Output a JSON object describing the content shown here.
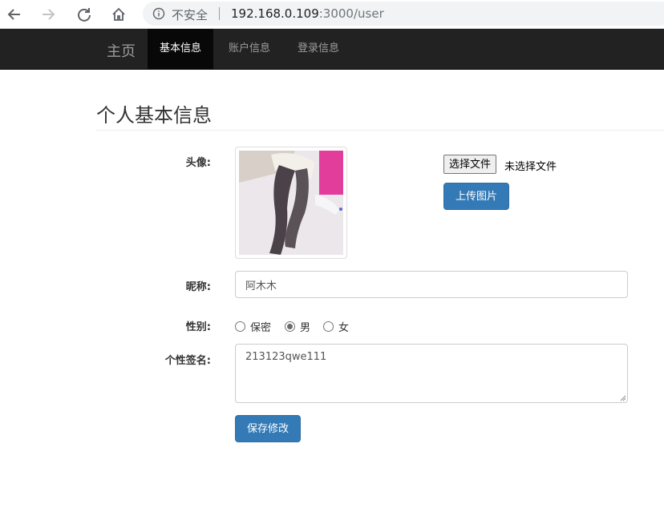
{
  "browser": {
    "security_label": "不安全",
    "url_host": "192.168.0.109",
    "url_rest": ":3000/user"
  },
  "navbar": {
    "brand": "主页",
    "links": [
      "基本信息",
      "账户信息",
      "登录信息"
    ],
    "active_index": 0
  },
  "page": {
    "title": "个人基本信息",
    "avatar_label": "头像:",
    "file_button": "选择文件",
    "file_status": "未选择文件",
    "upload_button": "上传图片",
    "nickname_label": "昵称:",
    "nickname_value": "阿木木",
    "gender_label": "性别:",
    "gender_options": [
      "保密",
      "男",
      "女"
    ],
    "gender_selected": 1,
    "signature_label": "个性签名:",
    "signature_value": "213123qwe111",
    "save_button": "保存修改"
  },
  "colors": {
    "navbar_bg": "#222222",
    "primary": "#337ab7"
  }
}
